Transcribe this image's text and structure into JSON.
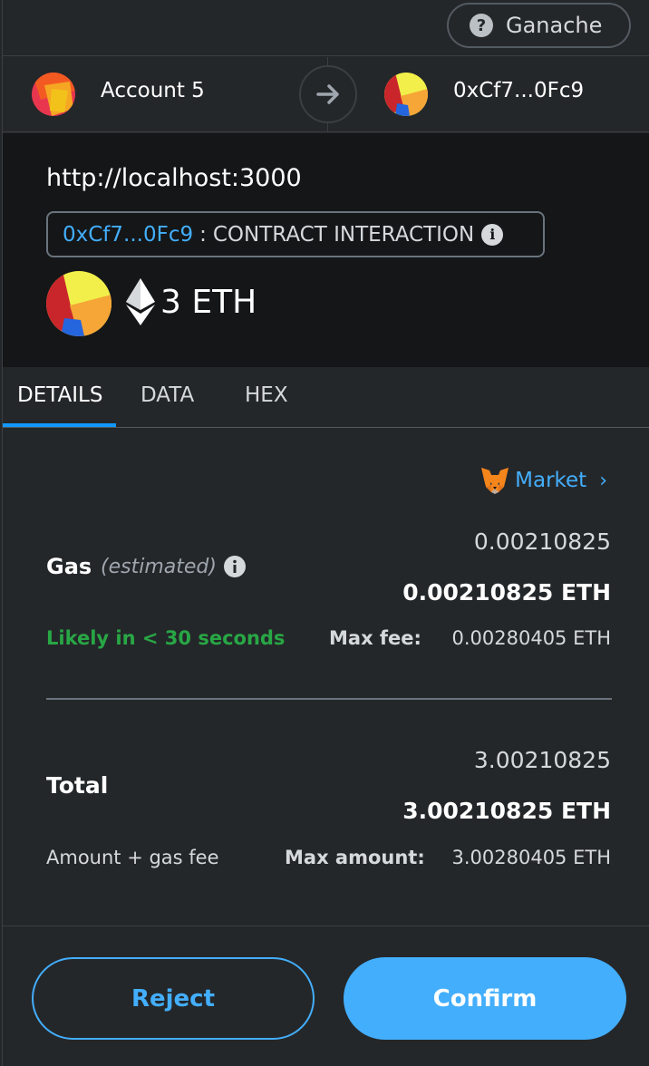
{
  "network": {
    "label": "Ganache",
    "icon": "question-icon"
  },
  "sender": {
    "name": "Account 5"
  },
  "recipient": {
    "name": "0xCf7...0Fc9"
  },
  "summary": {
    "origin": "http://localhost:3000",
    "contract_address": "0xCf7...0Fc9",
    "separator": ":",
    "interaction_type": "CONTRACT INTERACTION",
    "amount": "3 ETH"
  },
  "tabs": [
    {
      "label": "DETAILS",
      "active": true
    },
    {
      "label": "DATA",
      "active": false
    },
    {
      "label": "HEX",
      "active": false
    }
  ],
  "details": {
    "market_label": "Market",
    "gas": {
      "label": "Gas",
      "estimated": "(estimated)",
      "fiat": "0.00210825",
      "eth": "0.00210825 ETH",
      "likely": "Likely in < 30 seconds",
      "max_fee_label": "Max fee:",
      "max_fee": "0.00280405 ETH"
    },
    "total": {
      "label": "Total",
      "fiat": "3.00210825",
      "eth": "3.00210825 ETH",
      "sublabel": "Amount + gas fee",
      "max_amount_label": "Max amount:",
      "max_amount": "3.00280405 ETH"
    }
  },
  "footer": {
    "reject_label": "Reject",
    "confirm_label": "Confirm"
  },
  "colors": {
    "accent": "#43aefc",
    "success": "#28a745",
    "background": "#24272a",
    "summary_bg": "#141618"
  }
}
